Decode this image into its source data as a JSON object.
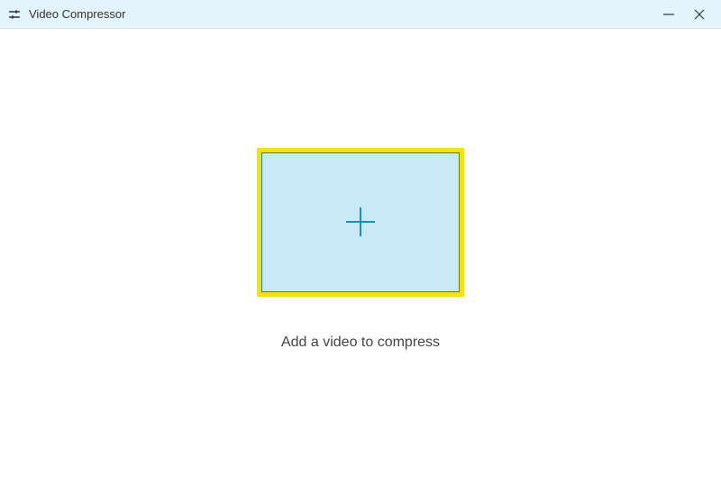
{
  "titlebar": {
    "app_icon": "settings-sliders-icon",
    "title": "Video Compressor"
  },
  "main": {
    "instruction": "Add a video to compress"
  },
  "colors": {
    "titlebar_bg": "#e3f4fc",
    "dropzone_border": "#f2e500",
    "dropzone_fill": "#c9e9f7",
    "plus_color": "#1a8fc4"
  }
}
